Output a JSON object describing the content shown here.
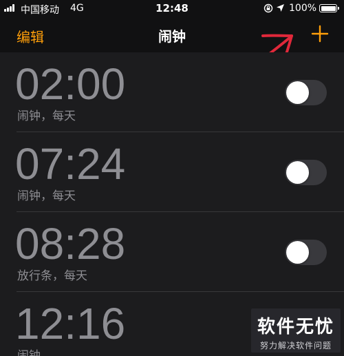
{
  "status_bar": {
    "carrier": "中国移动",
    "network": "4G",
    "time": "12:48",
    "battery": "100%"
  },
  "nav": {
    "edit_label": "编辑",
    "title": "闹钟",
    "add_icon": "plus-icon",
    "accent_color": "#ff9f0a"
  },
  "alarms": [
    {
      "time": "02:00",
      "label": "闹钟，每天",
      "enabled": false
    },
    {
      "time": "07:24",
      "label": "闹钟，每天",
      "enabled": false
    },
    {
      "time": "08:28",
      "label": "放行条，每天",
      "enabled": false
    },
    {
      "time": "12:16",
      "label": "闹钟",
      "enabled": false
    }
  ],
  "watermark": {
    "main": "软件无忧",
    "sub": "努力解决软件问题"
  },
  "colors": {
    "background": "#111112",
    "row_background": "#1c1c1e",
    "dim_text": "#8e8e93",
    "toggle_off": "#39393d",
    "annotation": "#e0283a"
  }
}
